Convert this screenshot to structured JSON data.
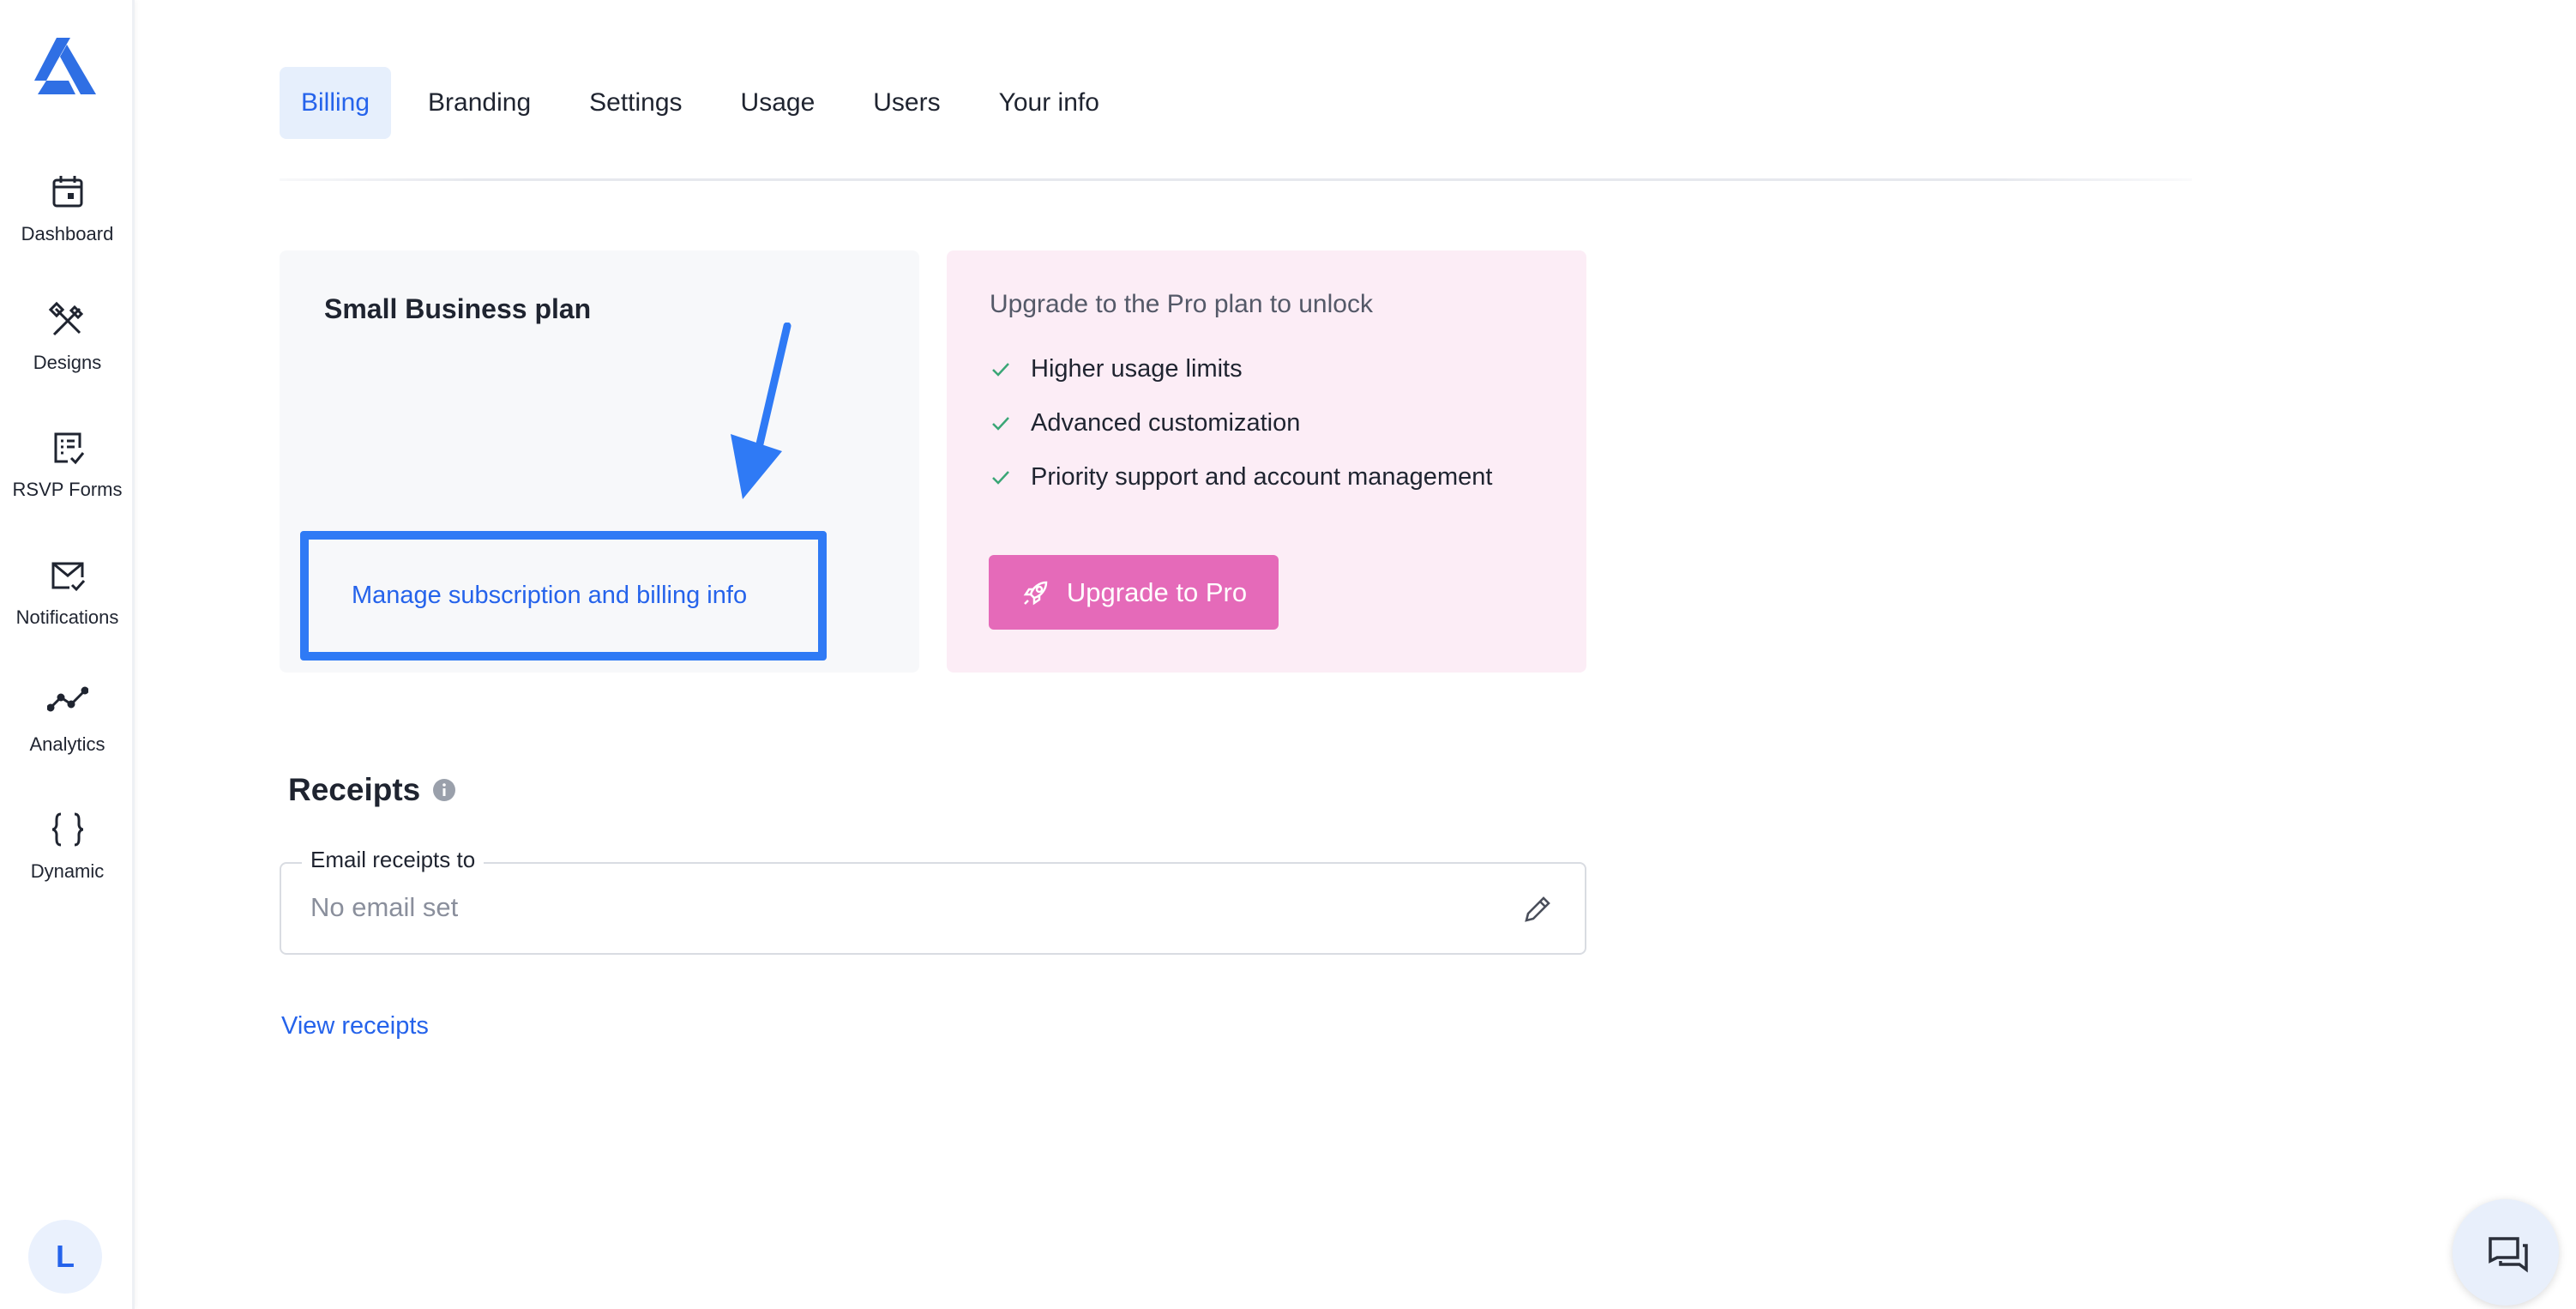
{
  "sidebar": {
    "items": [
      {
        "label": "Dashboard",
        "icon": "calendar-icon"
      },
      {
        "label": "Designs",
        "icon": "design-tools-icon"
      },
      {
        "label": "RSVP Forms",
        "icon": "form-check-icon"
      },
      {
        "label": "Notifications",
        "icon": "envelope-check-icon"
      },
      {
        "label": "Analytics",
        "icon": "line-chart-icon"
      },
      {
        "label": "Dynamic",
        "icon": "curly-braces-icon"
      }
    ],
    "avatar_initial": "L"
  },
  "tabs": [
    {
      "label": "Billing",
      "active": true
    },
    {
      "label": "Branding",
      "active": false
    },
    {
      "label": "Settings",
      "active": false
    },
    {
      "label": "Usage",
      "active": false
    },
    {
      "label": "Users",
      "active": false
    },
    {
      "label": "Your info",
      "active": false
    }
  ],
  "plan": {
    "title": "Small Business plan",
    "manage_link": "Manage subscription and billing info"
  },
  "upgrade": {
    "title": "Upgrade to the Pro plan to unlock",
    "features": [
      "Higher usage limits",
      "Advanced customization",
      "Priority support and account management"
    ],
    "button_label": "Upgrade to Pro"
  },
  "receipts": {
    "heading": "Receipts",
    "email_label": "Email receipts to",
    "email_value": "No email set",
    "view_link": "View receipts"
  },
  "colors": {
    "accent": "#2563eb",
    "highlight_box": "#2f7af5",
    "upgrade_button": "#e56ab9",
    "upgrade_card": "#fcedf6",
    "check": "#3aa676"
  }
}
